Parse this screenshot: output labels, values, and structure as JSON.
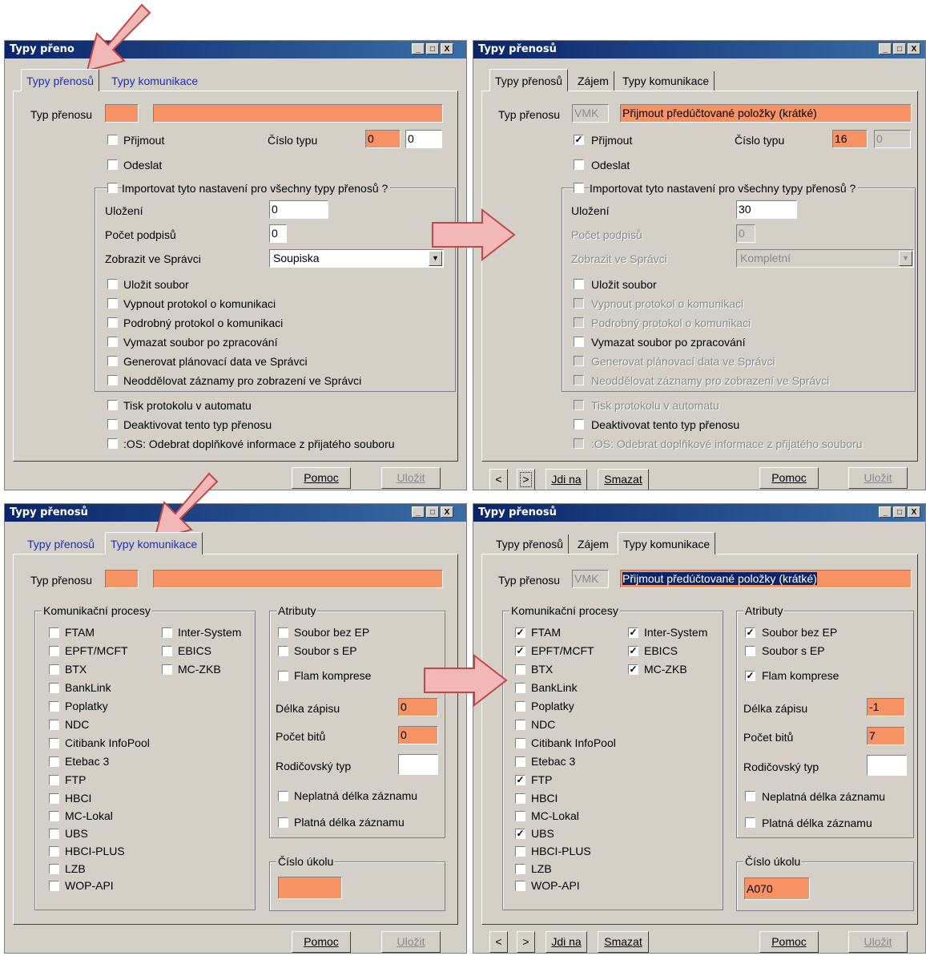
{
  "title": "Typy přenosů",
  "title_short": "Typy přeno",
  "window_buttons": [
    "_",
    "□",
    "X"
  ],
  "tabs": {
    "transfers": "Typy přenosů",
    "interest": "Zájem",
    "communication": "Typy komunikace"
  },
  "fields": {
    "transfer_type": "Typ přenosu",
    "receive": "Přijmout",
    "send": "Odeslat",
    "type_number": "Číslo typu",
    "import_all": "Importovat tyto nastavení pro všechny typy přenosů ?",
    "storage": "Uložení",
    "signatures": "Počet podpisů",
    "show_in_admin": "Zobrazit ve Správci",
    "save_file": "Uložit soubor",
    "disable_log": "Vypnout protokol o komunikaci",
    "detailed_log": "Podrobný protokol o komunikaci",
    "delete_file": "Vymazat soubor po zpracování",
    "gen_plan": "Generovat plánovací data ve Správci",
    "no_separate": "Neoddělovat záznamy pro zobrazení ve Správci",
    "print_log": "Tisk protokolu v automatu",
    "deactivate": "Deaktivovat tento typ přenosu",
    "os_remove": ":OS: Odebrat doplňkové informace z přijatého souboru"
  },
  "panel1": {
    "type_number_a": "0",
    "type_number_b": "0",
    "storage": "0",
    "signatures": "0",
    "admin_view": "Soupiska"
  },
  "panel2": {
    "code": "VMK",
    "name": "Přijmout předúčtované položky (krátké)",
    "type_number_a": "16",
    "type_number_b": "0",
    "storage": "30",
    "signatures": "0",
    "admin_view": "Kompletní"
  },
  "comm": {
    "group_processes": "Komunikační procesy",
    "group_attributes": "Atributy",
    "group_task": "Číslo úkolu",
    "processes_left": [
      "FTAM",
      "EPFT/MCFT",
      "BTX",
      "BankLink",
      "Poplatky",
      "NDC",
      "Citibank InfoPool",
      "Etebac 3",
      "FTP",
      "HBCI",
      "MC-Lokal",
      "UBS",
      "HBCI-PLUS",
      "LZB",
      "WOP-API"
    ],
    "processes_right": [
      "Inter-System",
      "EBICS",
      "MC-ZKB"
    ],
    "attr_no_ep": "Soubor bez EP",
    "attr_with_ep": "Soubor s EP",
    "attr_flam": "Flam komprese",
    "record_length": "Délka zápisu",
    "bits": "Počet bitů",
    "parent_type": "Rodičovský typ",
    "invalid_length": "Neplatná délka záznamu",
    "valid_length": "Platná délka záznamu"
  },
  "panel3": {
    "record_length": "0",
    "bits": "0"
  },
  "panel4": {
    "record_length": "-1",
    "bits": "7",
    "task_number": "A070"
  },
  "buttons": {
    "help": "Pomoc",
    "save": "Uložit",
    "goto": "Jdi na",
    "delete": "Smazat",
    "prev": "<",
    "next": ">"
  },
  "colors": {
    "accent_orange": "#f79264",
    "title_bar": "#0a246a",
    "window_bg": "#d4d0c8",
    "arrow_fill": "#f2b8b8"
  },
  "icons": {
    "check": "✓",
    "dropdown": "▼"
  }
}
